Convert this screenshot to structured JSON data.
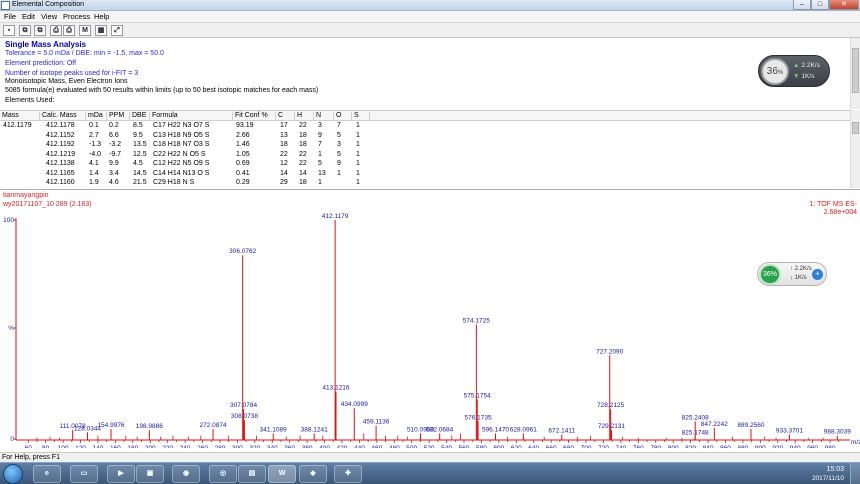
{
  "window": {
    "title": "Elemental Composition"
  },
  "menu": [
    "File",
    "Edit",
    "View",
    "Process",
    "Help"
  ],
  "toolbar": [
    {
      "icon": "save-icon",
      "glyph": "▪"
    },
    {
      "icon": "copy-icon",
      "glyph": "⧉"
    },
    {
      "icon": "copy-all-icon",
      "glyph": "⧉"
    },
    {
      "icon": "print-icon",
      "glyph": "⎙"
    },
    {
      "icon": "print-preview-icon",
      "glyph": "⎙"
    },
    {
      "icon": "m-icon",
      "glyph": "M"
    },
    {
      "icon": "table-icon",
      "glyph": "▦"
    },
    {
      "icon": "expand-icon",
      "glyph": "⤢"
    }
  ],
  "info": {
    "heading": "Single Mass Analysis",
    "line1": "Tolerance = 5.0 mDa   /   DBE: min = -1.5, max = 50.0",
    "line2": "Element prediction: Off",
    "line3": "Number of isotope peaks used for i-FIT = 3",
    "line4": "Monoisotopic Mass, Even Electron Ions",
    "line5": "5085 formula(e) evaluated with 50 results within limits (up to 50 best isotopic matches for each mass)",
    "line6": "Elements Used:"
  },
  "netwidget": {
    "percent": "36",
    "unit": "%",
    "up": "2.2K/s",
    "down": "1K/s"
  },
  "netwidget2": {
    "percent": "36%",
    "up": "2.2K/s",
    "down": "1K/s",
    "add": "+"
  },
  "table": {
    "columns": [
      "Mass",
      "Calc. Mass",
      "mDa",
      "PPM",
      "DBE",
      "Formula",
      "Fit Conf %",
      "C",
      "H",
      "N",
      "O",
      "S"
    ],
    "rows": [
      [
        "412.1179",
        "412.1178",
        "0.1",
        "0.2",
        "8.5",
        "C17  H22  N3  O7  S",
        "93.19",
        "17",
        "22",
        "3",
        "7",
        "1"
      ],
      [
        "",
        "412.1152",
        "2.7",
        "6.6",
        "9.5",
        "C13  H18  N9  O5  S",
        "2.66",
        "13",
        "18",
        "9",
        "5",
        "1"
      ],
      [
        "",
        "412.1192",
        "-1.3",
        "-3.2",
        "13.5",
        "C18  H18  N7  O3  S",
        "1.46",
        "18",
        "18",
        "7",
        "3",
        "1"
      ],
      [
        "",
        "412.1219",
        "-4.0",
        "-9.7",
        "12.5",
        "C22  H22  N  O5  S",
        "1.05",
        "22",
        "22",
        "1",
        "5",
        "1"
      ],
      [
        "",
        "412.1138",
        "4.1",
        "9.9",
        "4.5",
        "C12  H22  N5  O9  S",
        "0.69",
        "12",
        "22",
        "5",
        "9",
        "1"
      ],
      [
        "",
        "412.1165",
        "1.4",
        "3.4",
        "14.5",
        "C14  H14  N13  O  S",
        "0.41",
        "14",
        "14",
        "13",
        "1",
        "1"
      ],
      [
        "",
        "412.1160",
        "1.9",
        "4.6",
        "21.5",
        "C29  H18  N  S",
        "0.29",
        "29",
        "18",
        "1",
        "",
        "1"
      ]
    ]
  },
  "spectrum": {
    "sample": "tianmayangpin",
    "file": "wy20171107_10 289 (2.163)",
    "mode": "1: TOF MS ES-",
    "intensity": "2.68e+004"
  },
  "chart_data": {
    "type": "bar",
    "title": "",
    "xlabel": "m/z",
    "ylabel": "%",
    "xlim": [
      50,
      1000
    ],
    "ylim": [
      0,
      100
    ],
    "xticks": [
      60,
      80,
      100,
      120,
      140,
      160,
      180,
      200,
      220,
      240,
      260,
      280,
      300,
      320,
      340,
      360,
      380,
      400,
      420,
      440,
      460,
      480,
      500,
      520,
      540,
      560,
      580,
      600,
      620,
      640,
      660,
      680,
      700,
      720,
      740,
      760,
      780,
      800,
      820,
      840,
      860,
      880,
      900,
      920,
      940,
      960,
      980
    ],
    "yticks": [
      "100",
      "%",
      "0"
    ],
    "labeled_peaks": [
      {
        "x": 111.0078,
        "y": 4.5
      },
      {
        "x": 128.0344,
        "y": 3.5
      },
      {
        "x": 154.9976,
        "y": 5.0
      },
      {
        "x": 198.9886,
        "y": 4.5
      },
      {
        "x": 272.0874,
        "y": 5.0
      },
      {
        "x": 306.0762,
        "y": 84.0
      },
      {
        "x": 307.0784,
        "y": 14.0
      },
      {
        "x": 308.0738,
        "y": 9.0
      },
      {
        "x": 341.1089,
        "y": 3.0
      },
      {
        "x": 388.1241,
        "y": 3.0
      },
      {
        "x": 412.1179,
        "y": 100.0
      },
      {
        "x": 413.1216,
        "y": 22.0
      },
      {
        "x": 434.0999,
        "y": 14.5
      },
      {
        "x": 459.1136,
        "y": 6.5
      },
      {
        "x": 510.09,
        "y": 3.0
      },
      {
        "x": 532.0684,
        "y": 3.0
      },
      {
        "x": 574.1725,
        "y": 52.5
      },
      {
        "x": 575.1754,
        "y": 18.5
      },
      {
        "x": 576.1735,
        "y": 8.5
      },
      {
        "x": 596.147,
        "y": 3.0
      },
      {
        "x": 628.0961,
        "y": 3.0
      },
      {
        "x": 672.1411,
        "y": 2.5
      },
      {
        "x": 727.209,
        "y": 38.5
      },
      {
        "x": 728.2125,
        "y": 14.0
      },
      {
        "x": 729.2131,
        "y": 4.5
      },
      {
        "x": 825.1748,
        "y": 1.5
      },
      {
        "x": 825.2408,
        "y": 8.5
      },
      {
        "x": 847.2242,
        "y": 5.5
      },
      {
        "x": 889.256,
        "y": 5.0
      },
      {
        "x": 933.3701,
        "y": 2.5
      },
      {
        "x": 988.3039,
        "y": 2.0
      }
    ],
    "minor_peaks": [
      {
        "x": 70,
        "y": 1.0
      },
      {
        "x": 85,
        "y": 1.5
      },
      {
        "x": 96,
        "y": 1.0
      },
      {
        "x": 140,
        "y": 2.0
      },
      {
        "x": 172,
        "y": 2.0
      },
      {
        "x": 185,
        "y": 1.5
      },
      {
        "x": 212,
        "y": 1.5
      },
      {
        "x": 226,
        "y": 2.0
      },
      {
        "x": 244,
        "y": 1.5
      },
      {
        "x": 258,
        "y": 2.0
      },
      {
        "x": 290,
        "y": 2.0
      },
      {
        "x": 322,
        "y": 2.0
      },
      {
        "x": 356,
        "y": 1.5
      },
      {
        "x": 372,
        "y": 2.0
      },
      {
        "x": 398,
        "y": 2.0
      },
      {
        "x": 445,
        "y": 3.0
      },
      {
        "x": 470,
        "y": 2.0
      },
      {
        "x": 484,
        "y": 2.0
      },
      {
        "x": 495,
        "y": 1.5
      },
      {
        "x": 546,
        "y": 2.0
      },
      {
        "x": 556,
        "y": 3.0
      },
      {
        "x": 610,
        "y": 1.5
      },
      {
        "x": 652,
        "y": 1.5
      },
      {
        "x": 690,
        "y": 1.5
      },
      {
        "x": 705,
        "y": 2.0
      },
      {
        "x": 742,
        "y": 1.5
      },
      {
        "x": 760,
        "y": 1.0
      },
      {
        "x": 792,
        "y": 1.0
      },
      {
        "x": 810,
        "y": 1.0
      },
      {
        "x": 868,
        "y": 1.5
      },
      {
        "x": 905,
        "y": 1.5
      },
      {
        "x": 918,
        "y": 1.0
      },
      {
        "x": 955,
        "y": 1.0
      },
      {
        "x": 972,
        "y": 1.0
      }
    ],
    "colors": {
      "peaks": "#e01010",
      "labels": "#1a1aa0",
      "axis": "#e01010",
      "ticks": "#1a1aa0"
    }
  },
  "status": "For Help, press F1",
  "taskbar": {
    "apps": [
      {
        "icon": "ie-icon",
        "glyph": "e"
      },
      {
        "icon": "folder-icon",
        "glyph": "▭"
      },
      {
        "icon": "media-icon",
        "glyph": "▶"
      },
      {
        "icon": "app-icon",
        "glyph": "▣"
      },
      {
        "icon": "qq-icon",
        "glyph": "◉"
      },
      {
        "icon": "browser-icon",
        "glyph": "◎"
      },
      {
        "icon": "chart-app-icon",
        "glyph": "▤"
      },
      {
        "icon": "word-icon",
        "glyph": "W"
      },
      {
        "icon": "game-icon",
        "glyph": "◆"
      },
      {
        "icon": "tool-icon",
        "glyph": "✚"
      }
    ],
    "time": "15:03",
    "date": "2017/11/10"
  }
}
